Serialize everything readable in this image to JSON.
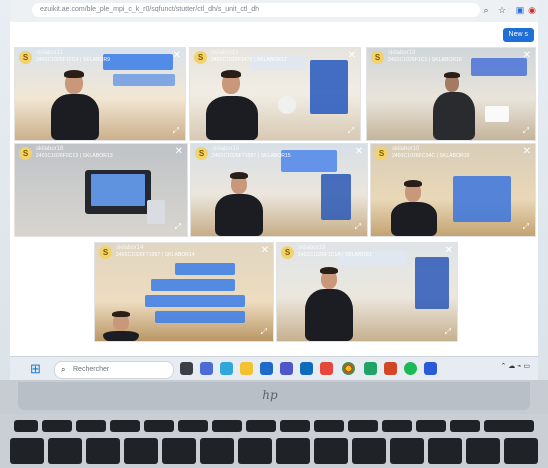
{
  "browser": {
    "url": "ezuikit.ae.com/ble_ple_mpi_c_k_r0/sqfunct/stutter/ctl_dh/s_unit_ctl_dh",
    "new_button": "New s"
  },
  "tiles": [
    {
      "id": "t1",
      "user": "skilabor11",
      "code": "2401C1026F1FC4 | SKLABOR9"
    },
    {
      "id": "t2",
      "user": "skilabor13",
      "code": "2401C1026F1472 | SKLABOR12"
    },
    {
      "id": "t3",
      "user": "skilabor13",
      "code": "2401C1026F1C1 | SKLABOR16"
    },
    {
      "id": "t4",
      "user": "skilabor18",
      "code": "2401C1026F0C13 | SKLABOR13"
    },
    {
      "id": "t5",
      "user": "skilabor15",
      "code": "2401C1026F71097 | SKLABOR15"
    },
    {
      "id": "t6",
      "user": "skilabor10",
      "code": "2401C1026FC04C | SKLABOR10"
    },
    {
      "id": "t7",
      "user": "skilabor14",
      "code": "2401C1026F71097 | SKLABOR14"
    },
    {
      "id": "t8",
      "user": "skilabor19",
      "code": "2401C1026F1C1A | SKLABOR1"
    }
  ],
  "taskbar": {
    "search_placeholder": "Rechercher"
  },
  "brand": {
    "logo_text": "hp"
  }
}
